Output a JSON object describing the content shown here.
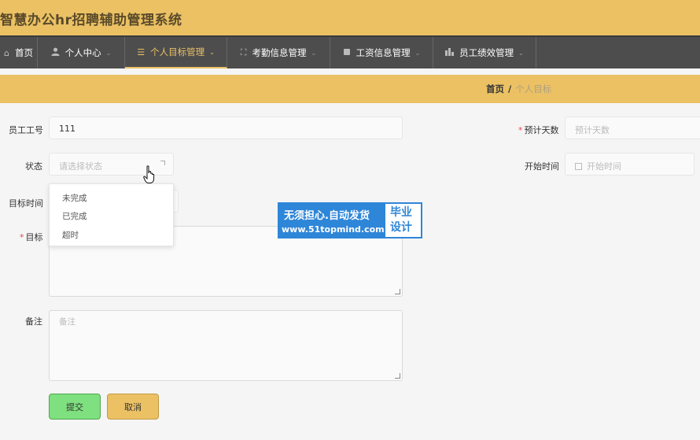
{
  "app": {
    "title": "智慧办公hr招聘辅助管理系统"
  },
  "nav": {
    "items": [
      {
        "label": "首页",
        "icon": "home-icon"
      },
      {
        "label": "个人中心",
        "icon": "user-icon"
      },
      {
        "label": "个人目标管理",
        "icon": "list-icon",
        "active": true
      },
      {
        "label": "考勤信息管理",
        "icon": "fullscreen-icon"
      },
      {
        "label": "工资信息管理",
        "icon": "card-icon"
      },
      {
        "label": "员工绩效管理",
        "icon": "chart-icon"
      }
    ]
  },
  "breadcrumb": {
    "home": "首页",
    "separator": "/",
    "current": "个人目标"
  },
  "form": {
    "employee_id": {
      "label": "员工工号",
      "value": "111"
    },
    "expected_days": {
      "label": "预计天数",
      "placeholder": "预计天数",
      "required": true
    },
    "status": {
      "label": "状态",
      "placeholder": "请选择状态",
      "options": [
        "未完成",
        "已完成",
        "超时"
      ]
    },
    "start_time": {
      "label": "开始时间",
      "placeholder": "开始时间"
    },
    "target_time": {
      "label": "目标时间"
    },
    "target": {
      "label": "目标",
      "required": true
    },
    "remark": {
      "label": "备注",
      "placeholder": "备注"
    }
  },
  "buttons": {
    "submit": "提交",
    "cancel": "取消"
  },
  "watermark": {
    "line1": "无须担心.自动发货",
    "line2": "www.51topmind.com",
    "badge_line1": "毕业",
    "badge_line2": "设计"
  },
  "colors": {
    "theme": "#ebc164",
    "nav_bg": "#4d4d4d",
    "submit": "#7ee07e",
    "watermark": "#2e86d8"
  }
}
